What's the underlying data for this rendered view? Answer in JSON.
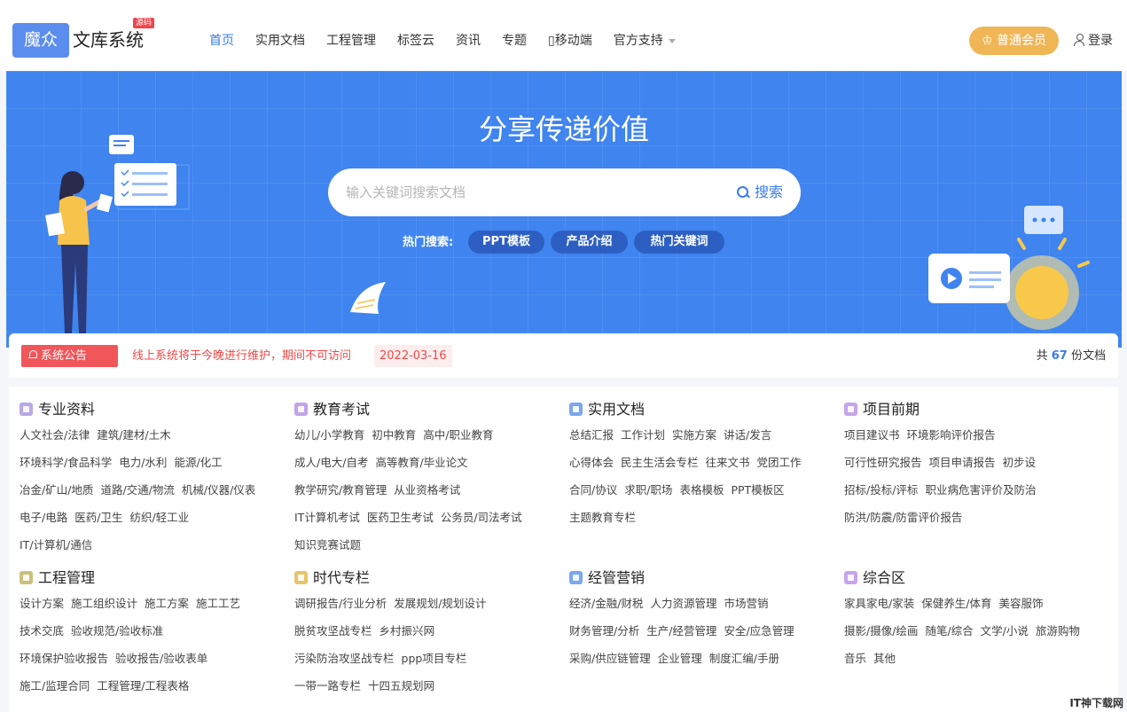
{
  "header": {
    "logo_box": "魔众",
    "logo_text": "文库系统",
    "logo_badge": "源码",
    "nav": [
      {
        "label": "首页",
        "active": true
      },
      {
        "label": "实用文档"
      },
      {
        "label": "工程管理"
      },
      {
        "label": "标签云"
      },
      {
        "label": "资讯"
      },
      {
        "label": "专题"
      },
      {
        "label": "▯移动端"
      },
      {
        "label": "官方支持",
        "dropdown": true
      }
    ],
    "vip_label": "♔ 普通会员",
    "login_label": "登录"
  },
  "banner": {
    "title": "分享传递价值",
    "search_placeholder": "输入关键词搜索文档",
    "search_button": "搜索",
    "hot_label": "热门搜索:",
    "hot_tags": [
      "PPT模板",
      "产品介绍",
      "热门关键词"
    ]
  },
  "notice": {
    "badge": "系统公告",
    "text": "线上系统将于今晚进行维护，期间不可访问",
    "date": "2022-03-16",
    "count_prefix": "共",
    "count": "67",
    "count_suffix": "份文档"
  },
  "categories": [
    {
      "title": "专业资料",
      "color": "#b8a8e6",
      "lines": [
        [
          "人文社会/法律",
          "建筑/建材/土木"
        ],
        [
          "环境科学/食品科学",
          "电力/水利",
          "能源/化工"
        ],
        [
          "冶金/矿山/地质",
          "道路/交通/物流",
          "机械/仪器/仪表"
        ],
        [
          "电子/电路",
          "医药/卫生",
          "纺织/轻工业"
        ],
        [
          "IT/计算机/通信"
        ]
      ]
    },
    {
      "title": "教育考试",
      "color": "#c2a3e8",
      "lines": [
        [
          "幼儿/小学教育",
          "初中教育",
          "高中/职业教育"
        ],
        [
          "成人/电大/自考",
          "高等教育/毕业论文"
        ],
        [
          "教学研究/教育管理",
          "从业资格考试"
        ],
        [
          "IT计算机考试",
          "医药卫生考试",
          "公务员/司法考试"
        ],
        [
          "知识竞赛试题"
        ]
      ]
    },
    {
      "title": "实用文档",
      "color": "#7aa7ee",
      "lines": [
        [
          "总结汇报",
          "工作计划",
          "实施方案",
          "讲话/发言"
        ],
        [
          "心得体会",
          "民主生活会专栏",
          "往来文书",
          "党团工作"
        ],
        [
          "合同/协议",
          "求职/职场",
          "表格模板",
          "PPT模板区"
        ],
        [
          "主题教育专栏"
        ]
      ]
    },
    {
      "title": "项目前期",
      "color": "#c6a5ea",
      "lines": [
        [
          "项目建议书",
          "环境影响评价报告"
        ],
        [
          "可行性研究报告",
          "项目申请报告",
          "初步设"
        ],
        [
          "招标/投标/评标",
          "职业病危害评价及防治"
        ],
        [
          "防洪/防震/防雷评价报告"
        ]
      ]
    },
    {
      "title": "工程管理",
      "color": "#c9c07a",
      "lines": [
        [
          "设计方案",
          "施工组织设计",
          "施工方案",
          "施工工艺"
        ],
        [
          "技术交底",
          "验收规范/验收标准"
        ],
        [
          "环境保护验收报告",
          "验收报告/验收表单"
        ],
        [
          "施工/监理合同",
          "工程管理/工程表格"
        ]
      ]
    },
    {
      "title": "时代专栏",
      "color": "#e8c46a",
      "lines": [
        [
          "调研报告/行业分析",
          "发展规划/规划设计"
        ],
        [
          "脱贫攻坚战专栏",
          "乡村振兴网"
        ],
        [
          "污染防治攻坚战专栏",
          "ppp项目专栏"
        ],
        [
          "一带一路专栏",
          "十四五规划网"
        ]
      ]
    },
    {
      "title": "经管营销",
      "color": "#7aa7ee",
      "lines": [
        [
          "经济/金融/财税",
          "人力资源管理",
          "市场营销"
        ],
        [
          "财务管理/分析",
          "生产/经营管理",
          "安全/应急管理"
        ],
        [
          "采购/供应链管理",
          "企业管理",
          "制度汇编/手册"
        ]
      ]
    },
    {
      "title": "综合区",
      "color": "#c6a5ea",
      "lines": [
        [
          "家具家电/家装",
          "保健养生/体育",
          "美容服饰"
        ],
        [
          "摄影/摄像/绘画",
          "随笔/综合",
          "文学/小说",
          "旅游购物"
        ],
        [
          "音乐",
          "其他"
        ]
      ]
    }
  ],
  "watermark": "IT神下载网"
}
